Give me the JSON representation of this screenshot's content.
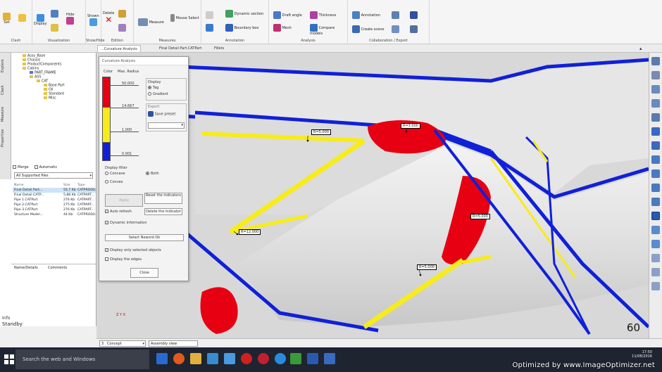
{
  "ribbon": {
    "groups": [
      "Clash",
      "Visualization",
      "Show/Hide",
      "Edition",
      "Measures",
      "Annotation",
      "Analysis",
      "Collaboration / Export"
    ],
    "buttons": {
      "set": "Set",
      "display": "Display",
      "hide": "Hide",
      "shown": "Shown",
      "delete": "Delete",
      "measure": "Measure",
      "mouse_select": "Mouse Select",
      "dynamic_section": "Dynamic section",
      "boundary_box": "Boundary box",
      "draft_angle": "Draft angle",
      "thickness": "Thickness",
      "mesh": "Mesh",
      "compare_models": "Compare models",
      "annotation": "Annotation",
      "create_scene": "Create scene"
    }
  },
  "tabs": [
    "...Curvature Analysis",
    "Final Detail Part.CATPart",
    "Fillets"
  ],
  "sidebar": {
    "vtabs": [
      "Explore",
      "Clash",
      "Measure",
      "Properties"
    ],
    "tree": [
      {
        "label": "Assy_Base",
        "indent": 3,
        "color": "yellow"
      },
      {
        "label": "Chassis",
        "indent": 3,
        "color": "yellow"
      },
      {
        "label": "ProductComponents",
        "indent": 3,
        "color": "yellow"
      },
      {
        "label": "Cabins",
        "indent": 3,
        "color": "yellow"
      },
      {
        "label": "PART_FRAME",
        "indent": 2,
        "color": "blue"
      },
      {
        "label": "ASS",
        "indent": 2,
        "color": "yellow"
      },
      {
        "label": "CAT",
        "indent": 1,
        "color": "yellow"
      },
      {
        "label": "Base Part",
        "indent": 0,
        "color": "yellow"
      },
      {
        "label": "Oil",
        "indent": 0,
        "color": "yellow"
      },
      {
        "label": "Standard",
        "indent": 0,
        "color": "yellow"
      },
      {
        "label": "Misc",
        "indent": 0,
        "color": "yellow"
      }
    ],
    "merge_label": "Merge",
    "automatic_label": "Automatic",
    "file_select": "All Supported files",
    "file_columns": [
      "Name",
      "Size",
      "Type"
    ],
    "files": [
      [
        "Final Detail Part...",
        "55,7 Kb",
        "CATPRODU..."
      ],
      [
        "Final Detail.CATP...",
        "5,88 Kb",
        "CATPART..."
      ],
      [
        "Pipe 1.CATPart",
        "276 Kb",
        "CATPART..."
      ],
      [
        "Pipe 2.CATPart",
        "275 Kb",
        "CATPART..."
      ],
      [
        "Pipe 3.CATPart",
        "276 Kb",
        "CATPART..."
      ],
      [
        "Structure Model...",
        "44 Kb",
        "CATPRODU..."
      ]
    ],
    "prop_columns": [
      "Name/Details",
      "Comments"
    ],
    "status_label": "Info",
    "status_value": "Standby"
  },
  "dialog": {
    "title": "Curvature Analysis",
    "scale_header_left": "Color",
    "scale_header_right": "Max. Radius",
    "scale_values": [
      "50.000",
      "14.667",
      "1.000",
      "0.001"
    ],
    "display_group": "Display",
    "display_options": [
      "Tag",
      "Gradient"
    ],
    "export_group": "Export",
    "save_preset": "Save preset",
    "display_filter_label": "Display filter",
    "filter_options": [
      "Concave",
      "Both",
      "Convex"
    ],
    "apply_button": "Apply",
    "reset_indicators": "Reset the indicators",
    "auto_refresh": "Auto refresh",
    "delete_indicator": "Delete the indicator",
    "dynamic_info": "Dynamic information",
    "select_all": "Select Neword Ok",
    "display_only_selected": "Display only selected objects",
    "display_edges": "Display the edges",
    "close_button": "Close"
  },
  "viewport": {
    "annotations": [
      "R=5.000",
      "R=3.000",
      "R=5.000",
      "R=12.000",
      "R=5.000"
    ],
    "fps": "60",
    "triad_label": "Z Y X"
  },
  "command_row": {
    "level": "3",
    "mode": "Concept",
    "view": "Assembly view"
  },
  "taskbar": {
    "search_placeholder": "Search the web and Windows",
    "time": "17:50",
    "date": "11/08/2016"
  },
  "watermark": "Optimized by www.ImageOptimizer.net",
  "colors": {
    "curv_red": "#e60012",
    "curv_yellow": "#f7ec1a",
    "curv_blue": "#1020d8",
    "taskbar": "#1e2430"
  }
}
